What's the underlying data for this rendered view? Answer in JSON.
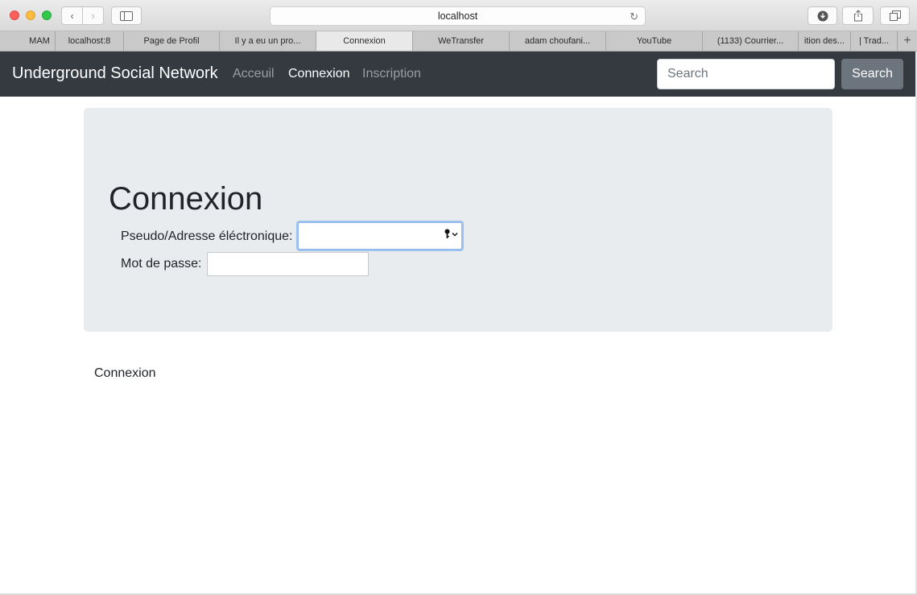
{
  "browser": {
    "address": "localhost",
    "tabs": [
      {
        "label": "MAM",
        "active": false
      },
      {
        "label": "localhost:8",
        "active": false
      },
      {
        "label": "Page de Profil",
        "active": false
      },
      {
        "label": "Il y a eu un pro...",
        "active": false
      },
      {
        "label": "Connexion",
        "active": true
      },
      {
        "label": "WeTransfer",
        "active": false
      },
      {
        "label": "adam choufani...",
        "active": false
      },
      {
        "label": "YouTube",
        "active": false
      },
      {
        "label": "(1133) Courrier...",
        "active": false
      },
      {
        "label": "ition des...",
        "active": false
      },
      {
        "label": "| Trad...",
        "active": false
      }
    ],
    "new_tab": "+"
  },
  "navbar": {
    "brand": "Underground Social Network",
    "links": [
      {
        "label": "Acceuil",
        "active": false
      },
      {
        "label": "Connexion",
        "active": true
      },
      {
        "label": "Inscription",
        "active": false
      }
    ],
    "search_placeholder": "Search",
    "search_button": "Search"
  },
  "jumbotron": {
    "title": "Connexion",
    "username_label": "Pseudo/Adresse éléctronique:",
    "username_value": "",
    "password_label": "Mot de passe:",
    "password_value": ""
  },
  "footer": {
    "text": "Connexion"
  },
  "colors": {
    "navbar_bg": "#343a40",
    "jumbotron_bg": "#e9ecef",
    "search_button_bg": "#6c757d",
    "focus_ring": "#9ec3f0"
  },
  "icons": [
    "back-icon",
    "forward-icon",
    "sidebar-icon",
    "reload-icon",
    "download-icon",
    "share-icon",
    "tabs-icon",
    "key-icon",
    "chevron-down-icon"
  ]
}
